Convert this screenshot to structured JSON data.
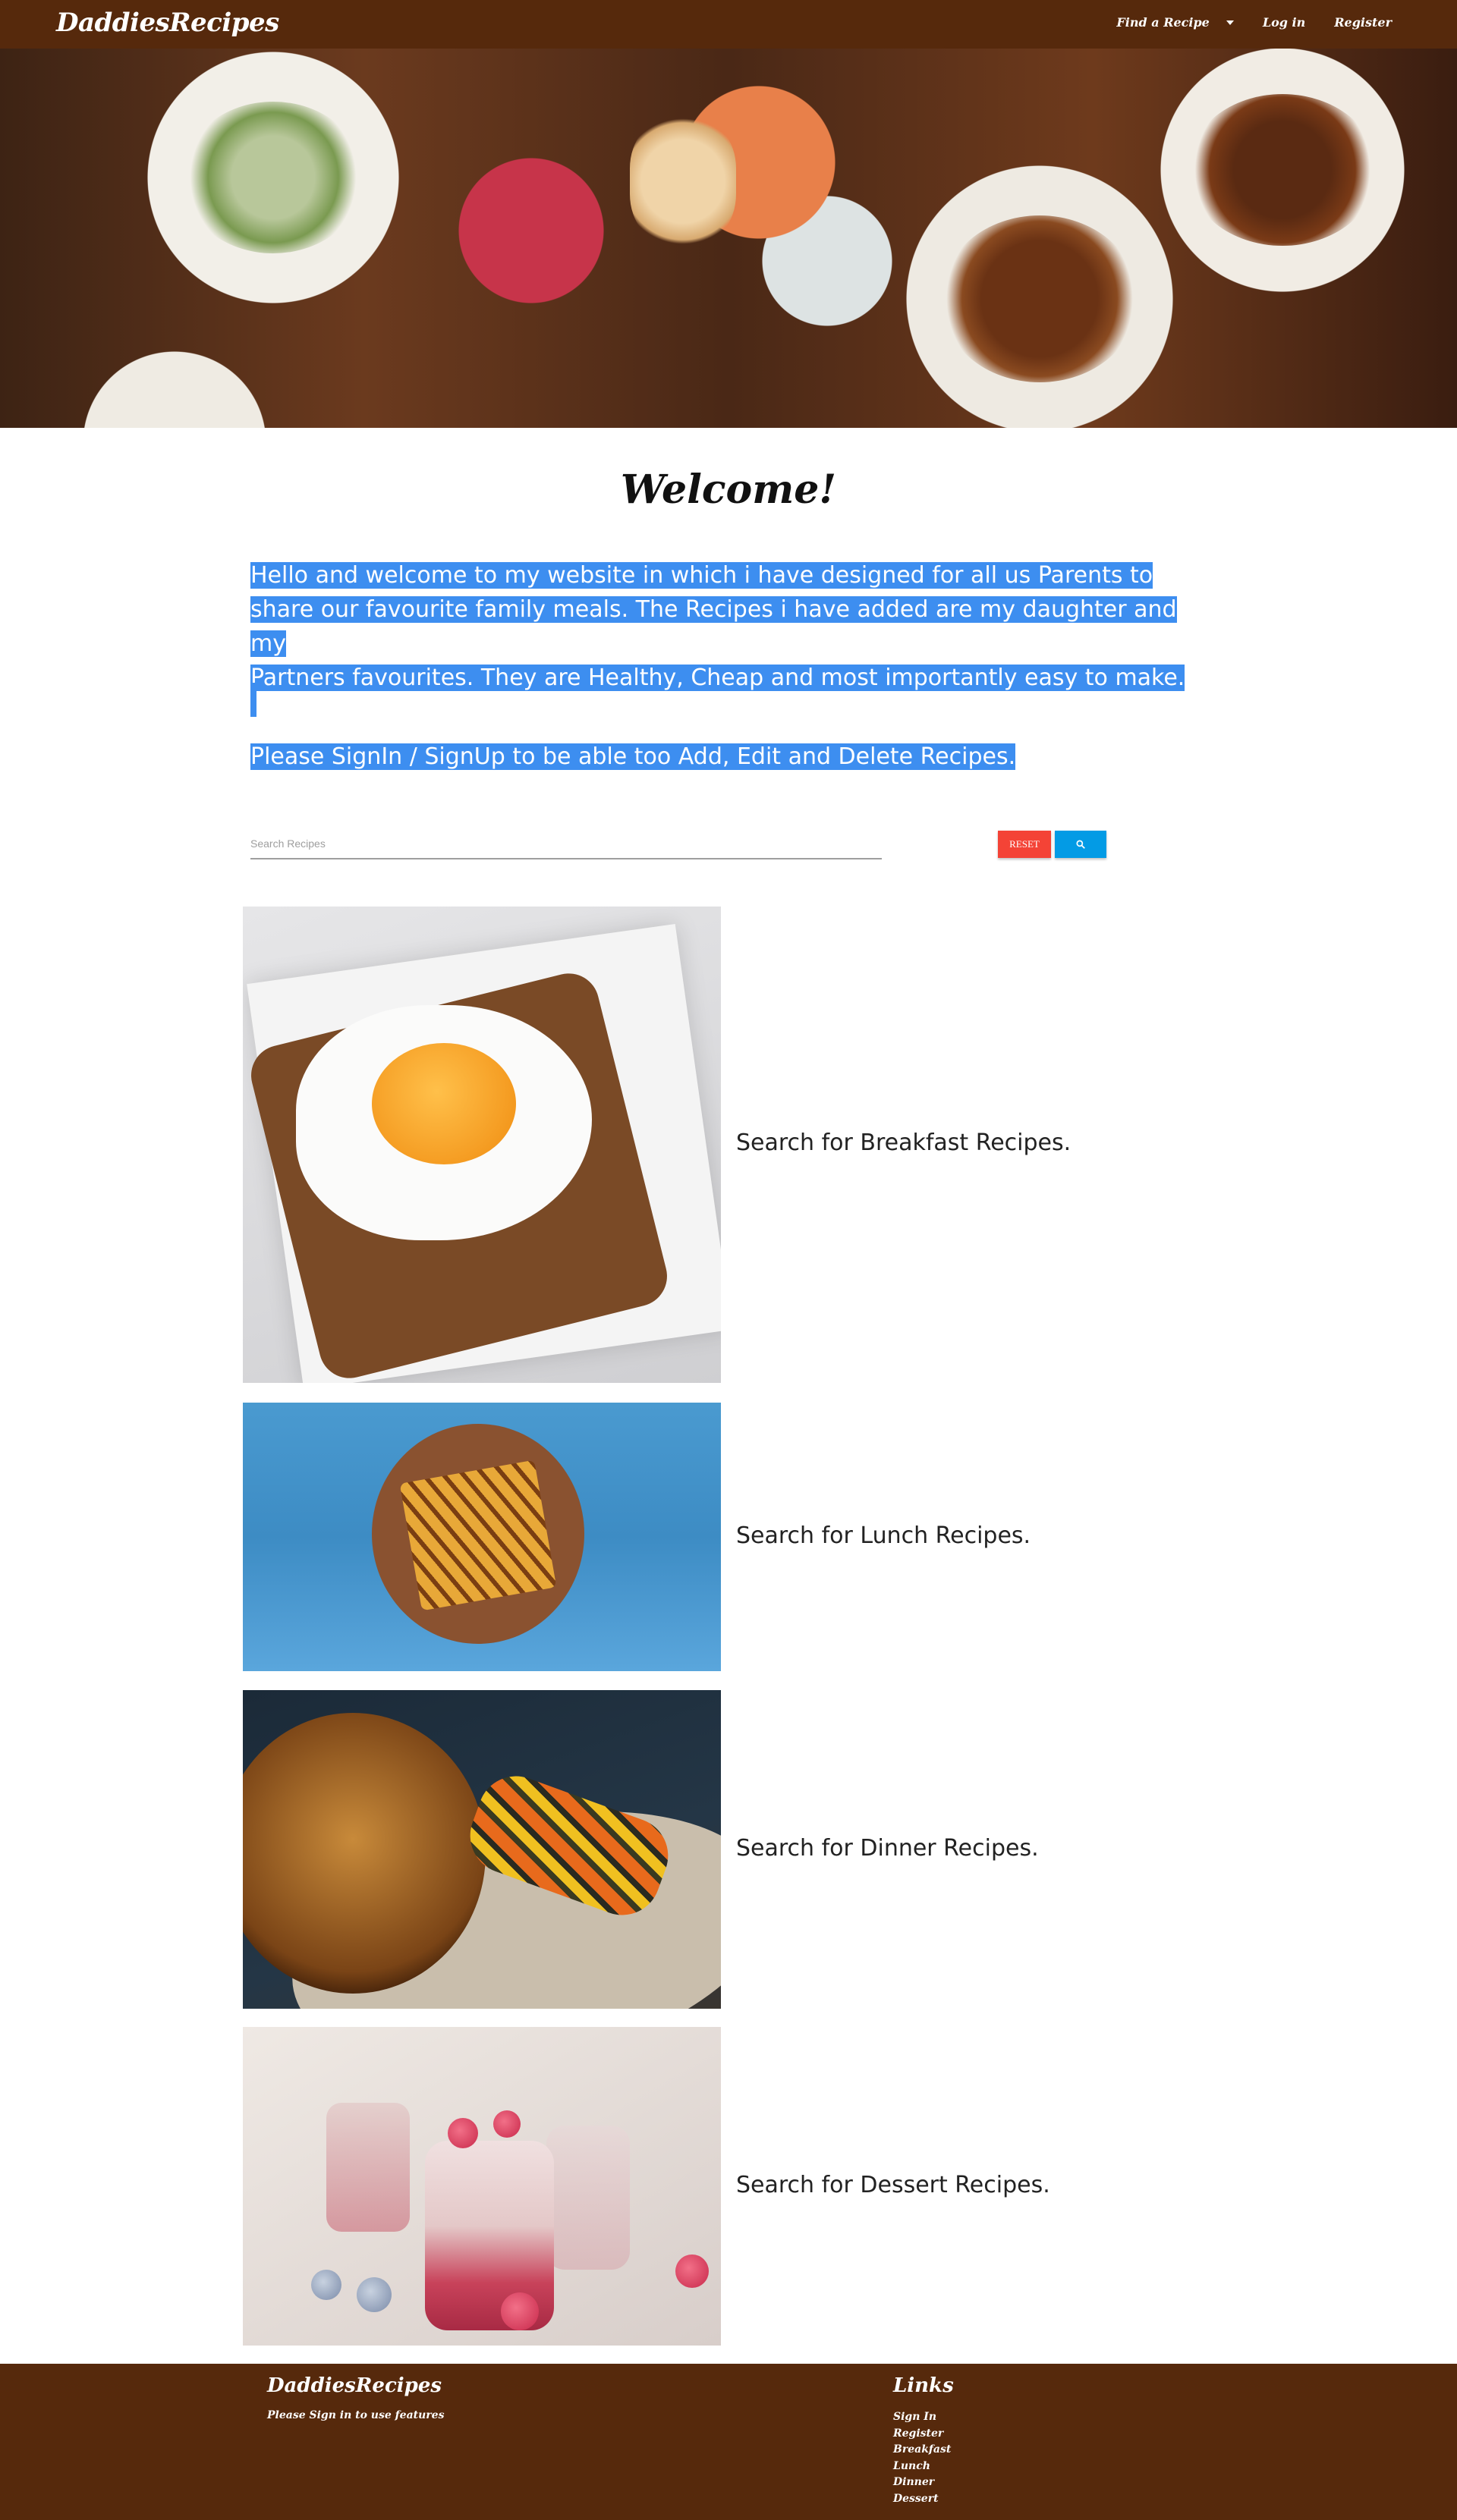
{
  "header": {
    "brand": "DaddiesRecipes",
    "nav": {
      "find_recipe": "Find a Recipe",
      "login": "Log in",
      "register": "Register"
    }
  },
  "main": {
    "welcome": "Welcome!",
    "intro_lines": [
      "Hello and welcome to my website in which i have designed for all us Parents to",
      "share our favourite family meals. The Recipes i have added are my daughter and my",
      "Partners favourites. They are Healthy, Cheap and most importantly easy to make."
    ],
    "signin_note": "Please SignIn / SignUp to be able too Add, Edit and Delete Recipes.",
    "search": {
      "placeholder": "Search Recipes",
      "value": "",
      "reset_label": "RESET",
      "search_icon": "search-icon"
    },
    "categories": [
      {
        "label": "Search for Breakfast Recipes.",
        "image": "breakfast-image"
      },
      {
        "label": "Search for Lunch Recipes.",
        "image": "lunch-image"
      },
      {
        "label": "Search for Dinner Recipes.",
        "image": "dinner-image"
      },
      {
        "label": "Search for Dessert Recipes.",
        "image": "dessert-image"
      }
    ]
  },
  "footer": {
    "brand": "DaddiesRecipes",
    "note": "Please Sign in to use features",
    "links_title": "Links",
    "links": [
      "Sign In",
      "Register",
      "Breakfast",
      "Lunch",
      "Dinner",
      "Dessert"
    ]
  },
  "colors": {
    "brand_brown": "#56290c",
    "highlight": "#3d8ef0",
    "reset": "#f44336",
    "search": "#039be5"
  }
}
